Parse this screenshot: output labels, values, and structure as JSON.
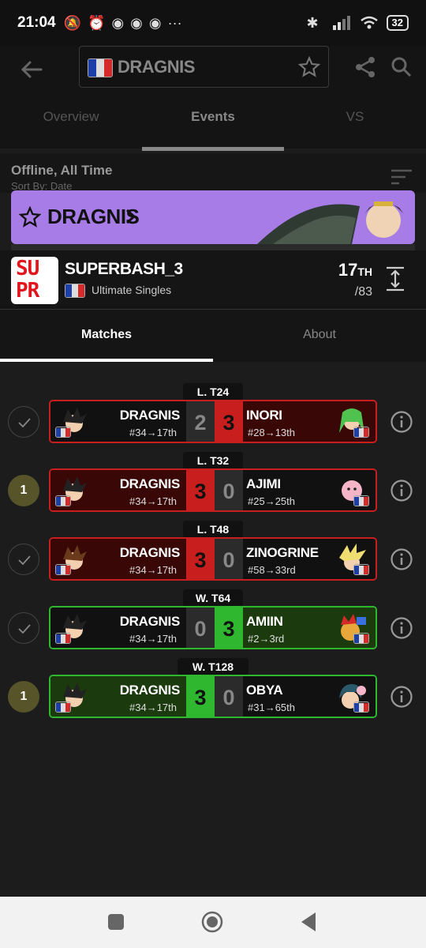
{
  "status": {
    "time": "21:04",
    "battery": "32"
  },
  "header": {
    "player": "DRAGNIS"
  },
  "top_tabs": [
    {
      "label": "Overview"
    },
    {
      "label": "Events"
    },
    {
      "label": "VS"
    }
  ],
  "filter": {
    "title": "Offline, All Time",
    "sort": "Sort By: Date"
  },
  "banner": {
    "name": "DRAGNIS"
  },
  "event": {
    "title": "SUPERBASH_3",
    "logo_lines": [
      "SU",
      "PR"
    ],
    "game": "Ultimate Singles",
    "placement": "17",
    "placement_suffix": "TH",
    "total": "/83"
  },
  "event_tabs": [
    {
      "label": "Matches"
    },
    {
      "label": "About"
    }
  ],
  "colors": {
    "loss": "#c81e1e",
    "win": "#2fb82f",
    "loss_bg": "#3a0707",
    "win_bg": "#1b3b0e",
    "neutral_score": "#2b2b2b"
  },
  "matches": [
    {
      "round": "L. T24",
      "badge": "check",
      "p1": "DRAGNIS",
      "p1_seed": "#34→17th",
      "p2": "INORI",
      "p2_seed": "#28→13th",
      "s1": "2",
      "s2": "3",
      "result": "loss"
    },
    {
      "round": "L. T32",
      "badge": "1",
      "p1": "DRAGNIS",
      "p1_seed": "#34→17th",
      "p2": "AJIMI",
      "p2_seed": "#25→25th",
      "s1": "3",
      "s2": "0",
      "result": "loss_win"
    },
    {
      "round": "L. T48",
      "badge": "check",
      "p1": "DRAGNIS",
      "p1_seed": "#34→17th",
      "p2": "ZINOGRINE",
      "p2_seed": "#58→33rd",
      "s1": "3",
      "s2": "0",
      "result": "loss_win"
    },
    {
      "round": "W. T64",
      "badge": "check",
      "p1": "DRAGNIS",
      "p1_seed": "#34→17th",
      "p2": "AMIIN",
      "p2_seed": "#2→3rd",
      "s1": "0",
      "s2": "3",
      "result": "win_loss"
    },
    {
      "round": "W. T128",
      "badge": "1",
      "p1": "DRAGNIS",
      "p1_seed": "#34→17th",
      "p2": "OBYA",
      "p2_seed": "#31→65th",
      "s1": "3",
      "s2": "0",
      "result": "win"
    }
  ]
}
